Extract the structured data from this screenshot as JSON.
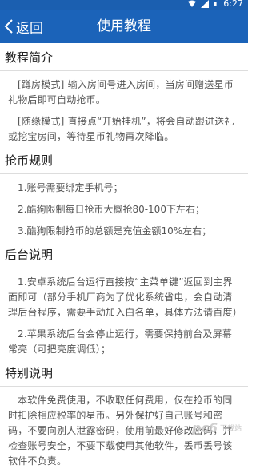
{
  "status_bar": {
    "time": "6:27"
  },
  "header": {
    "back_label": "返回",
    "title": "使用教程"
  },
  "sections": [
    {
      "title": "教程简介",
      "paragraphs": [
        "[蹲房模式] 输入房间号进入房间，当房间赠送星币礼物后即可自动抢币。",
        "[随缘模式] 直接点“开始挂机”，将会自动跟进送礼或挖宝房间，等待星币礼物再次降临。"
      ]
    },
    {
      "title": "抢币规则",
      "items": [
        "1.账号需要绑定手机号；",
        "2.酷狗限制每日抢币大概抢80-100下左右；",
        "3.酷狗限制抢币的总额是充值金额10%左右；"
      ]
    },
    {
      "title": "后台说明",
      "paragraphs": [
        "1.安卓系统后台运行直接按“主菜单键”返回到主界面即可（部分手机厂商为了优化系统省电，会自动清理后台程序，需要手动加入白名单，具体方法请百度）",
        "2.苹果系统后台会停止运行，需要保持前台及屏幕常亮（可把亮度调低）；"
      ]
    },
    {
      "title": "特别说明",
      "paragraphs": [
        "本软件免费使用，不收取任何费用，仅在抢币的同时扣除相应税率的星币。另外保护好自己账号和密码，不要向别人泄露密码，使用前最好修改密码，并检查账号安全，不要下载使用其他软件，丢币丢号该软件不负责。"
      ]
    }
  ],
  "watermark": {
    "text": "pc6",
    "sub": "下载站"
  }
}
